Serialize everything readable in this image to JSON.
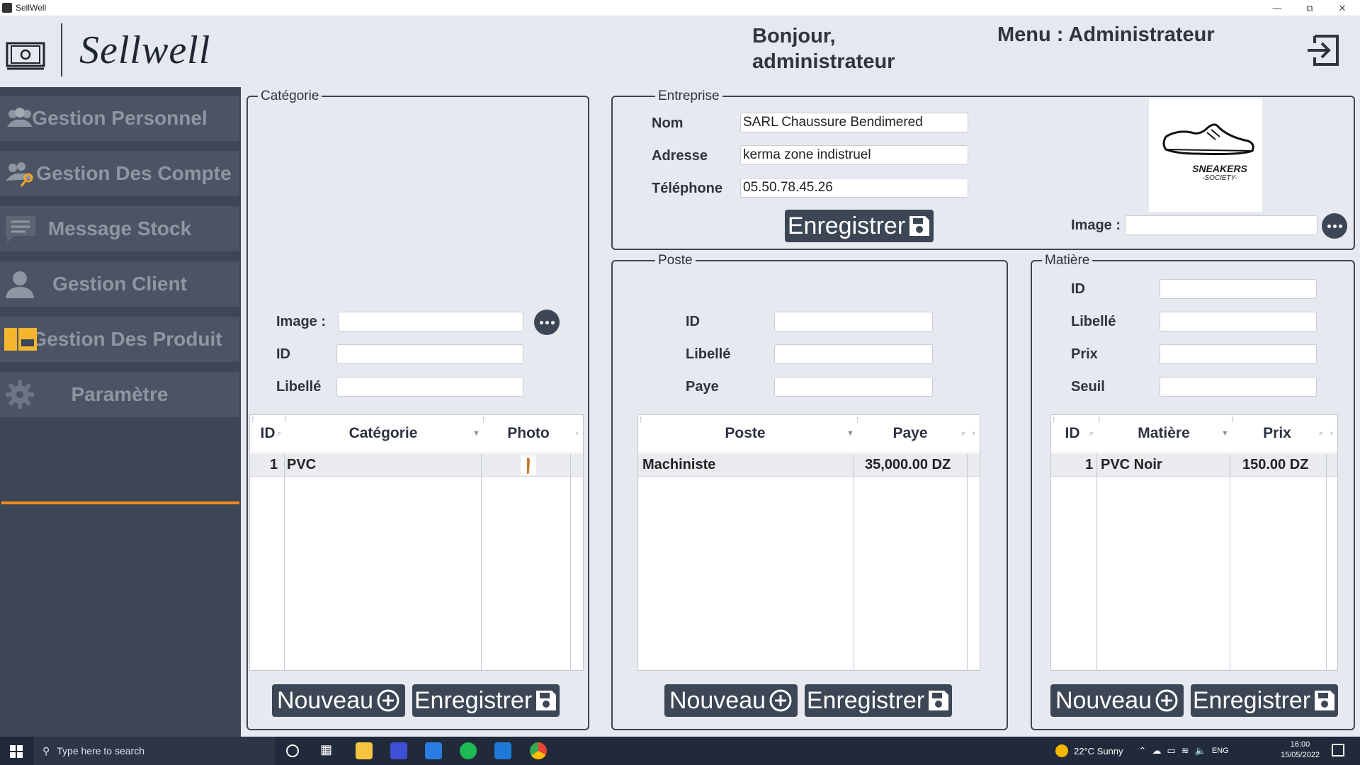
{
  "window": {
    "title": "SellWell",
    "controls": [
      "minimize",
      "restore",
      "close"
    ]
  },
  "header": {
    "brand": "Sellwell",
    "greeting_line1": "Bonjour,",
    "greeting_line2": "administrateur",
    "menu_title": "Menu : Administrateur",
    "logout_icon": "logout-icon"
  },
  "sidebar": {
    "items": [
      {
        "label": "Gestion Personnel",
        "icon": "people-icon"
      },
      {
        "label": "Gestion Des Compte",
        "icon": "people-key-icon"
      },
      {
        "label": "Message Stock",
        "icon": "message-icon"
      },
      {
        "label": "Gestion Client",
        "icon": "person-icon"
      },
      {
        "label": "Gestion Des Produit",
        "icon": "product-icon"
      },
      {
        "label": "Paramètre",
        "icon": "gear-icon"
      }
    ],
    "active": "Paramètre",
    "accent": "#f58a1f"
  },
  "categorie": {
    "legend": "Catégorie",
    "image_label": "Image :",
    "id_label": "ID",
    "libelle_label": "Libellé",
    "image_value": "",
    "id_value": "",
    "libelle_value": "",
    "columns": [
      "ID",
      "Catégorie",
      "Photo"
    ],
    "rows": [
      {
        "id": "1",
        "categorie": "PVC",
        "photo": "shoe-thumbnail"
      }
    ],
    "nouveau": "Nouveau",
    "enregistrer": "Enregistrer"
  },
  "entreprise": {
    "legend": "Entreprise",
    "nom_label": "Nom",
    "adresse_label": "Adresse",
    "telephone_label": "Téléphone",
    "nom_value": "SARL Chaussure Bendimered",
    "adresse_value": "kerma zone indistruel",
    "telephone_value": "05.50.78.45.26",
    "enregistrer": "Enregistrer",
    "image_label": "Image :",
    "image_value": "",
    "logo_line1": "SNEAKERS",
    "logo_line2": "-SOCIETY-"
  },
  "poste": {
    "legend": "Poste",
    "id_label": "ID",
    "libelle_label": "Libellé",
    "paye_label": "Paye",
    "columns": [
      "Poste",
      "Paye"
    ],
    "rows": [
      {
        "poste": "Machiniste",
        "paye": "35,000.00 DZ"
      }
    ],
    "nouveau": "Nouveau",
    "enregistrer": "Enregistrer"
  },
  "matiere": {
    "legend": "Matière",
    "id_label": "ID",
    "libelle_label": "Libellé",
    "prix_label": "Prix",
    "seuil_label": "Seuil",
    "columns": [
      "ID",
      "Matière",
      "Prix"
    ],
    "rows": [
      {
        "id": "1",
        "matiere": "PVC Noir",
        "prix": "150.00 DZ"
      }
    ],
    "nouveau": "Nouveau",
    "enregistrer": "Enregistrer"
  },
  "taskbar": {
    "search_placeholder": "Type here to search",
    "weather": "22°C  Sunny",
    "language": "ENG",
    "time": "16:00",
    "date": "15/05/2022"
  }
}
